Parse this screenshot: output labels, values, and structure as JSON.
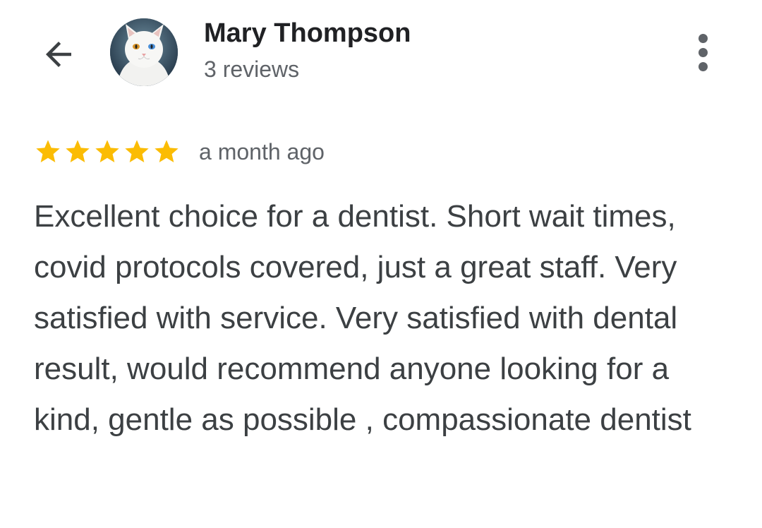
{
  "header": {
    "back_icon": "arrow-back-icon",
    "avatar_icon": "white-cat-avatar",
    "author_name": "Mary Thompson",
    "review_count": "3 reviews",
    "more_icon": "more-vert-icon"
  },
  "review": {
    "rating": 5,
    "rating_max": 5,
    "star_color": "#FBBC04",
    "date": "a month ago",
    "text": "Excellent choice for a dentist. Short wait times, covid protocols covered, just a great staff. Very satisfied with service. Very satisfied with dental result, would recommend anyone looking for a kind, gentle as possible , compassionate dentist"
  },
  "colors": {
    "name": "#202124",
    "secondary": "#5f6368",
    "body_text": "#3c4043"
  }
}
